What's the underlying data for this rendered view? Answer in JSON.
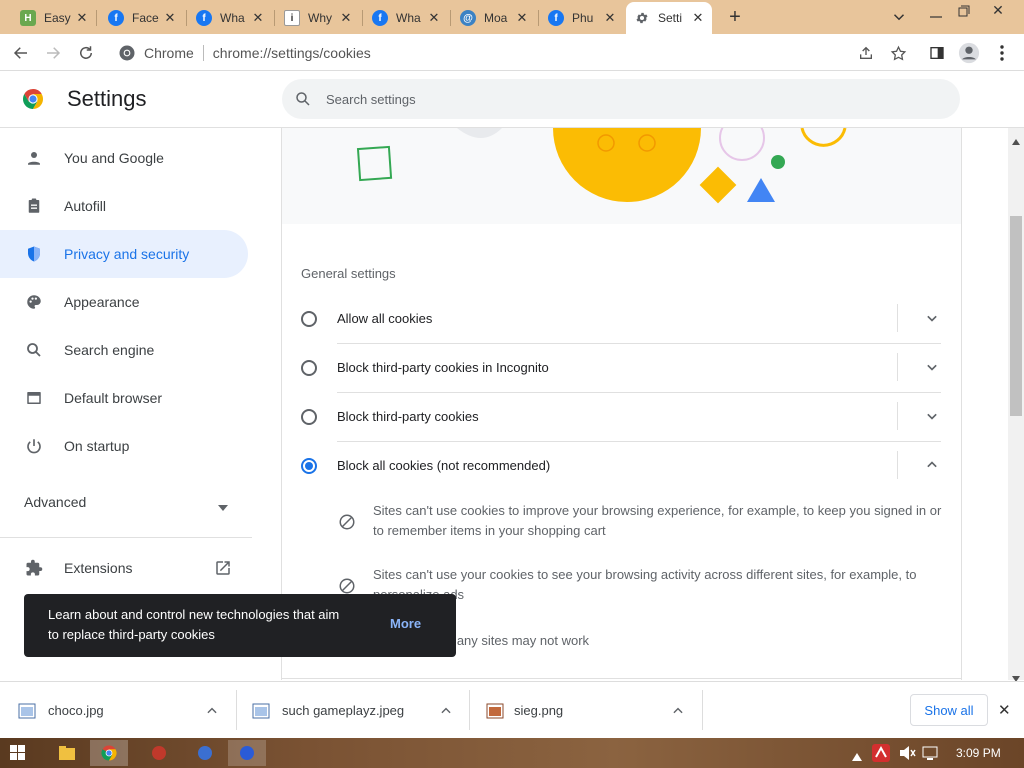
{
  "tabs": [
    {
      "title": "Easy",
      "favicon": "app-icon",
      "color": "#6aa84f"
    },
    {
      "title": "Face",
      "favicon": "facebook-icon",
      "color": "#1877f2"
    },
    {
      "title": "Wha",
      "favicon": "facebook-icon",
      "color": "#1877f2"
    },
    {
      "title": "Why",
      "favicon": "info-icon",
      "color": "#ffffff"
    },
    {
      "title": "Wha",
      "favicon": "facebook-icon",
      "color": "#1877f2"
    },
    {
      "title": "Moa",
      "favicon": "at-icon",
      "color": "#3b82c4"
    },
    {
      "title": "Phu",
      "favicon": "facebook-icon",
      "color": "#1877f2"
    },
    {
      "title": "Setti",
      "favicon": "gear-icon",
      "color": "#5f6368"
    }
  ],
  "omnibox": {
    "site": "Chrome",
    "url_prefix": "chrome://",
    "url_path": "settings/cookies"
  },
  "header": {
    "title": "Settings",
    "search_placeholder": "Search settings"
  },
  "sidebar": {
    "items": [
      {
        "label": "You and Google",
        "icon": "person-icon"
      },
      {
        "label": "Autofill",
        "icon": "clipboard-icon"
      },
      {
        "label": "Privacy and security",
        "icon": "shield-icon"
      },
      {
        "label": "Appearance",
        "icon": "palette-icon"
      },
      {
        "label": "Search engine",
        "icon": "search-icon"
      },
      {
        "label": "Default browser",
        "icon": "browser-icon"
      },
      {
        "label": "On startup",
        "icon": "power-icon"
      }
    ],
    "advanced": "Advanced",
    "extensions": "Extensions"
  },
  "main": {
    "section_title": "General settings",
    "options": [
      {
        "label": "Allow all cookies",
        "checked": false
      },
      {
        "label": "Block third-party cookies in Incognito",
        "checked": false
      },
      {
        "label": "Block third-party cookies",
        "checked": false
      },
      {
        "label": "Block all cookies (not recommended)",
        "checked": true
      }
    ],
    "bullets": [
      {
        "line1": "Sites can't use cookies to improve your browsing experience, for example, to keep you signed in or",
        "line2": "to remember items in your shopping cart"
      },
      {
        "line1": "Sites can't use your cookies to see your browsing activity across different sites, for example, to",
        "line2": "personalize ads"
      },
      {
        "line1": "Features on many sites may not work"
      }
    ]
  },
  "toast": {
    "line1": "Learn about and control new technologies that aim",
    "line2": "to replace third-party cookies",
    "action": "More"
  },
  "downloads": {
    "items": [
      {
        "name": "choco.jpg"
      },
      {
        "name": "such gameplayz.jpeg"
      },
      {
        "name": "sieg.png"
      }
    ],
    "show_all": "Show all"
  },
  "taskbar": {
    "time": "3:09 PM"
  },
  "colors": {
    "accent": "#1a73e8",
    "tabstrip": "#e8c59b"
  }
}
